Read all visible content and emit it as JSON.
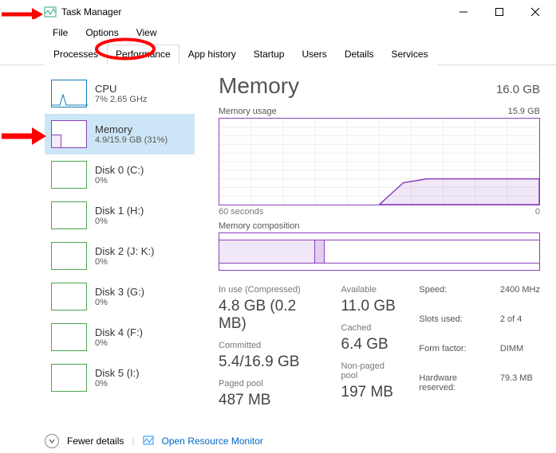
{
  "window": {
    "title": "Task Manager"
  },
  "menu": {
    "file": "File",
    "options": "Options",
    "view": "View"
  },
  "tabs": {
    "processes": "Processes",
    "performance": "Performance",
    "app_history": "App history",
    "startup": "Startup",
    "users": "Users",
    "details": "Details",
    "services": "Services"
  },
  "sidebar": {
    "items": [
      {
        "title": "CPU",
        "sub": "7% 2.65 GHz"
      },
      {
        "title": "Memory",
        "sub": "4.9/15.9 GB (31%)"
      },
      {
        "title": "Disk 0 (C:)",
        "sub": "0%"
      },
      {
        "title": "Disk 1 (H:)",
        "sub": "0%"
      },
      {
        "title": "Disk 2 (J: K:)",
        "sub": "0%"
      },
      {
        "title": "Disk 3 (G:)",
        "sub": "0%"
      },
      {
        "title": "Disk 4 (F:)",
        "sub": "0%"
      },
      {
        "title": "Disk 5 (I:)",
        "sub": "0%"
      }
    ]
  },
  "detail": {
    "heading": "Memory",
    "total": "16.0 GB",
    "usage_label": "Memory usage",
    "usage_max": "15.9 GB",
    "x_left": "60 seconds",
    "x_right": "0",
    "comp_label": "Memory composition",
    "stats": {
      "in_use_label": "In use (Compressed)",
      "in_use_value": "4.8 GB (0.2 MB)",
      "available_label": "Available",
      "available_value": "11.0 GB",
      "committed_label": "Committed",
      "committed_value": "5.4/16.9 GB",
      "cached_label": "Cached",
      "cached_value": "6.4 GB",
      "paged_label": "Paged pool",
      "paged_value": "487 MB",
      "nonpaged_label": "Non-paged pool",
      "nonpaged_value": "197 MB"
    },
    "props": {
      "speed_l": "Speed:",
      "speed_v": "2400 MHz",
      "slots_l": "Slots used:",
      "slots_v": "2 of 4",
      "form_l": "Form factor:",
      "form_v": "DIMM",
      "hw_l": "Hardware reserved:",
      "hw_v": "79.3 MB"
    }
  },
  "footer": {
    "fewer": "Fewer details",
    "orm": "Open Resource Monitor"
  },
  "chart_data": {
    "type": "line",
    "title": "Memory usage",
    "xlabel": "seconds",
    "ylabel": "GB",
    "ylim": [
      0,
      15.9
    ],
    "x": [
      60,
      55,
      50,
      45,
      40,
      35,
      30,
      25,
      20,
      15,
      10,
      5,
      0
    ],
    "values": [
      0,
      0,
      0,
      0,
      0,
      0,
      0,
      4.0,
      4.8,
      4.9,
      4.9,
      4.9,
      4.9
    ]
  }
}
